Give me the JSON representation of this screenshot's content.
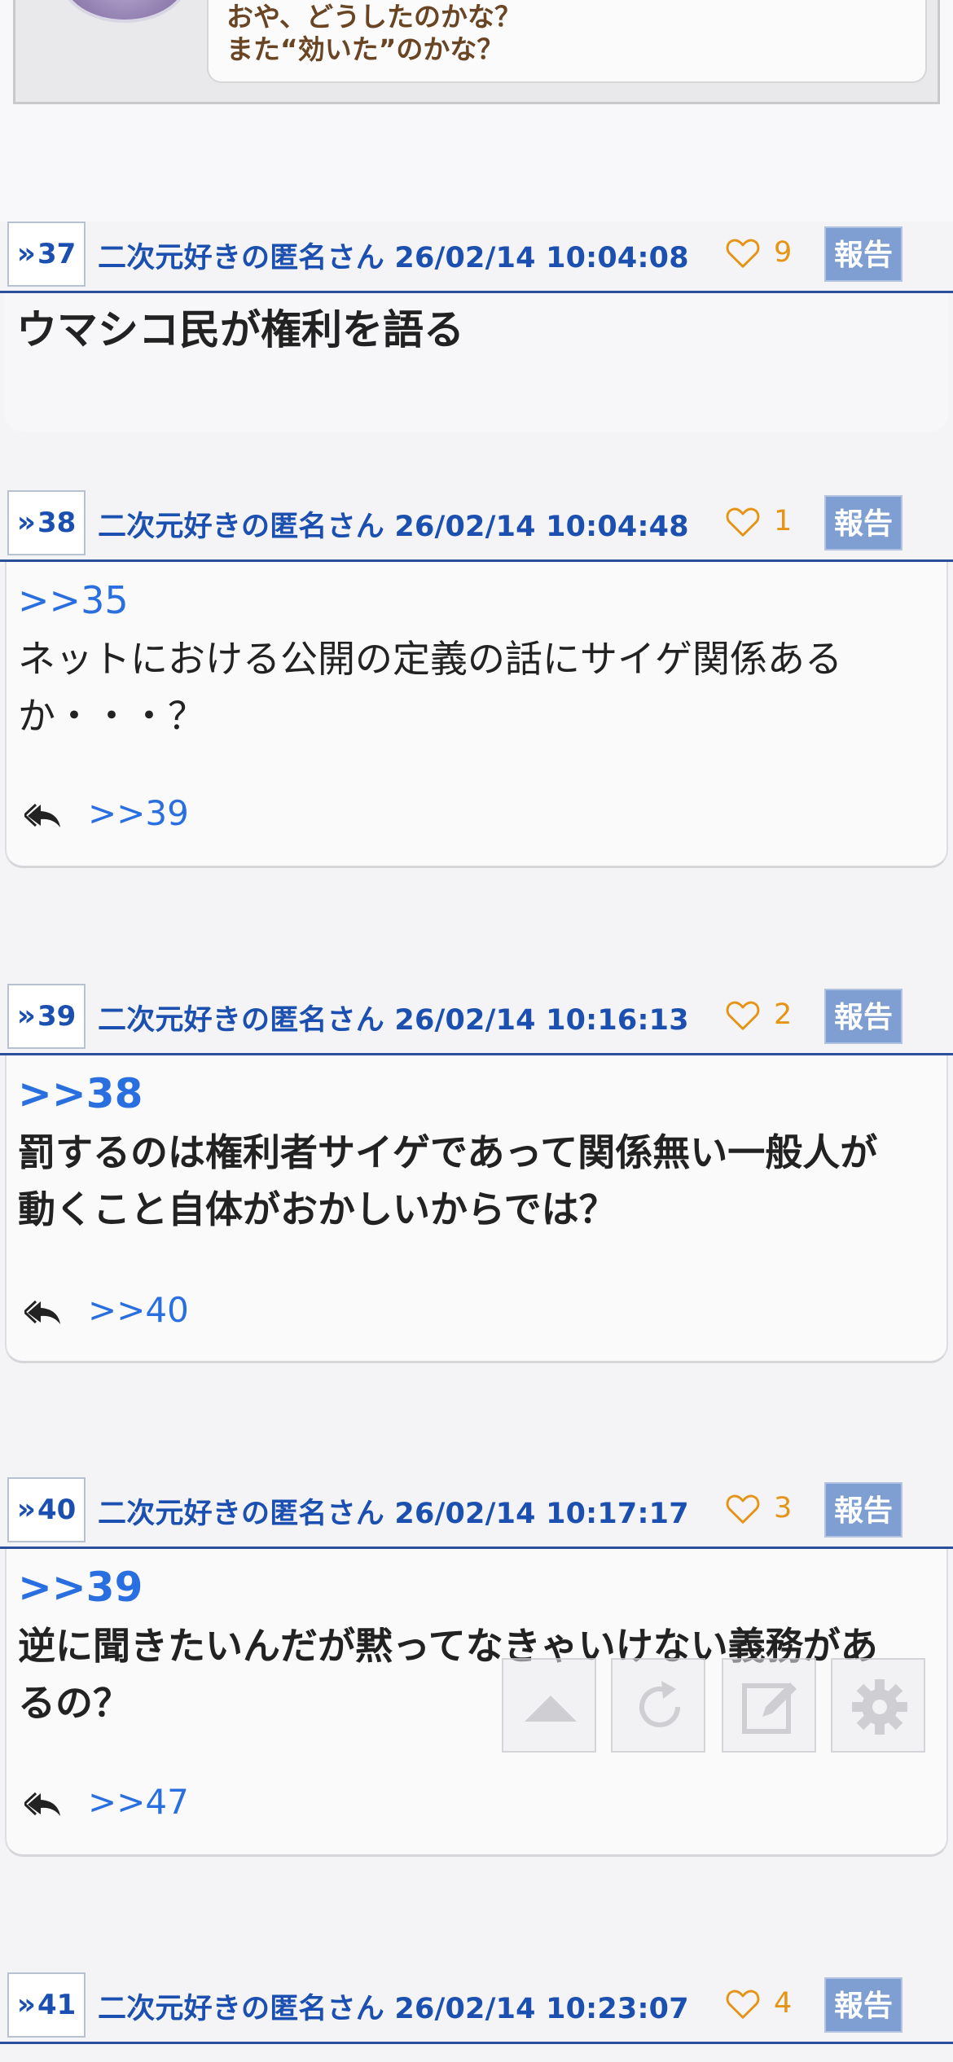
{
  "top_image": {
    "line1": "おや、どうしたのかな？",
    "line2": "また“効いた”のかな？"
  },
  "like_icon": "heart-outline-icon",
  "reply_icon": "reply-all-icon",
  "posts": [
    {
      "number": "37",
      "author": "二次元好きの匿名さん",
      "datetime": "26/02/14 10:04:08",
      "likes": "9",
      "report_label": "報告",
      "lines": [
        "ウマシコ民が権利を語る"
      ]
    },
    {
      "number": "38",
      "author": "二次元好きの匿名さん",
      "datetime": "26/02/14 10:04:48",
      "likes": "1",
      "report_label": "報告",
      "anchor": ">>35",
      "lines": [
        "ネットにおける公開の定義の話にサイゲ関係ある",
        "か・・・？"
      ],
      "replies": ">>39"
    },
    {
      "number": "39",
      "author": "二次元好きの匿名さん",
      "datetime": "26/02/14 10:16:13",
      "likes": "2",
      "report_label": "報告",
      "anchor": ">>38",
      "lines": [
        "罰するのは権利者サイゲであって関係無い一般人が",
        "動くこと自体がおかしいからでは？"
      ],
      "replies": ">>40"
    },
    {
      "number": "40",
      "author": "二次元好きの匿名さん",
      "datetime": "26/02/14 10:17:17",
      "likes": "3",
      "report_label": "報告",
      "anchor": ">>39",
      "lines": [
        "逆に聞きたいんだが黙ってなきゃいけない義務があ",
        "るの？"
      ],
      "replies": ">>47"
    },
    {
      "number": "41",
      "author": "二次元好きの匿名さん",
      "datetime": "26/02/14 10:23:07",
      "likes": "4",
      "report_label": "報告"
    }
  ],
  "toolbar": {
    "icons": [
      "triangle-up-icon",
      "refresh-icon",
      "edit-icon",
      "gear-icon"
    ]
  },
  "colors": {
    "link_blue": "#1b4fb0",
    "anchor_blue": "#2a6fe0",
    "like_orange": "#e59415",
    "report_bg": "#7f9fd3",
    "header_rule": "#2c4f9c"
  }
}
